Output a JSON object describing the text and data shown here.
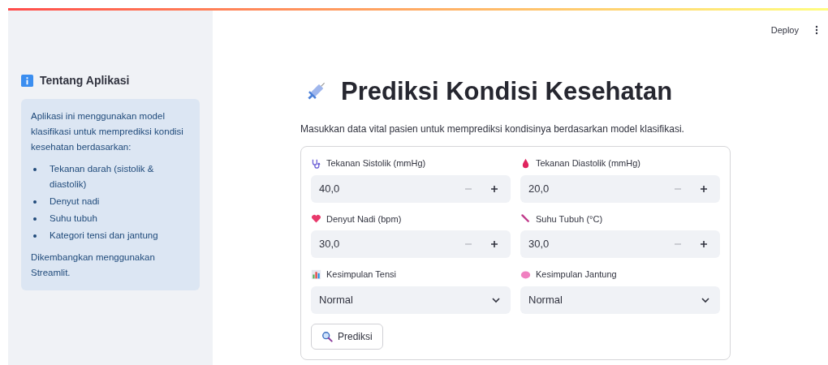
{
  "header": {
    "deploy": "Deploy"
  },
  "sidebar": {
    "title": "Tentang Aplikasi",
    "intro": "Aplikasi ini menggunakan model klasifikasi untuk memprediksi kondisi kesehatan berdasarkan:",
    "items": [
      "Tekanan darah (sistolik & diastolik)",
      "Denyut nadi",
      "Suhu tubuh",
      "Kategori tensi dan jantung"
    ],
    "footer": "Dikembangkan menggunakan Streamlit."
  },
  "main": {
    "title": "Prediksi Kondisi Kesehatan",
    "subtitle": "Masukkan data vital pasien untuk memprediksi kondisinya berdasarkan model klasifikasi.",
    "fields": [
      {
        "kind": "number",
        "label": "Tekanan Sistolik (mmHg)",
        "value": "40,0",
        "minus_disabled": true
      },
      {
        "kind": "number",
        "label": "Tekanan Diastolik (mmHg)",
        "value": "20,0",
        "minus_disabled": true
      },
      {
        "kind": "number",
        "label": "Denyut Nadi (bpm)",
        "value": "30,0",
        "minus_disabled": true
      },
      {
        "kind": "number",
        "label": "Suhu Tubuh (°C)",
        "value": "30,0",
        "minus_disabled": true
      },
      {
        "kind": "select",
        "label": "Kesimpulan Tensi",
        "value": "Normal"
      },
      {
        "kind": "select",
        "label": "Kesimpulan Jantung",
        "value": "Normal"
      }
    ],
    "button": "Prediksi"
  }
}
